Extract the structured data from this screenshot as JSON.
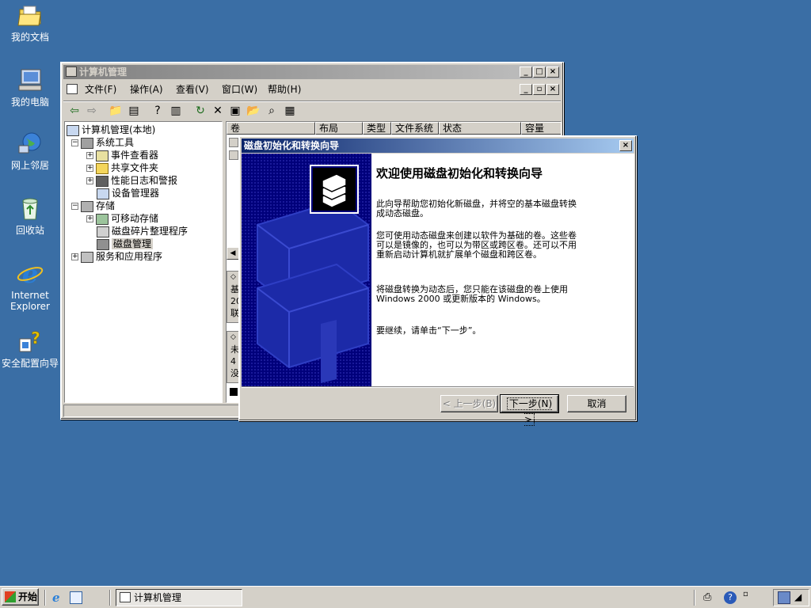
{
  "desktop": {
    "icons": [
      {
        "label": "我的文档",
        "icon": "my-documents-icon"
      },
      {
        "label": "我的电脑",
        "icon": "my-computer-icon"
      },
      {
        "label": "网上邻居",
        "icon": "network-icon"
      },
      {
        "label": "回收站",
        "icon": "recycle-bin-icon"
      },
      {
        "label_line1": "Internet",
        "label_line2": "Explorer",
        "icon": "ie-icon"
      },
      {
        "label": "安全配置向导",
        "icon": "security-wizard-icon"
      }
    ]
  },
  "main_window": {
    "title": "计算机管理",
    "menu": [
      "文件(F)",
      "操作(A)",
      "查看(V)",
      "窗口(W)",
      "帮助(H)"
    ],
    "tree": {
      "root": "计算机管理(本地)",
      "system_tools": "系统工具",
      "event_viewer": "事件查看器",
      "shared_folders": "共享文件夹",
      "perf_logs": "性能日志和警报",
      "device_manager": "设备管理器",
      "storage": "存储",
      "removable_storage": "可移动存储",
      "defrag": "磁盘碎片整理程序",
      "disk_mgmt": "磁盘管理",
      "services_apps": "服务和应用程序"
    },
    "columns": [
      "卷",
      "布局",
      "类型",
      "文件系统",
      "状态",
      "容量"
    ],
    "left_glimpse": [
      {
        "line1": "基",
        "line2": "20",
        "line3": "联"
      },
      {
        "line1": "未",
        "line2": "4",
        "line3": "没"
      }
    ]
  },
  "wizard": {
    "title": "磁盘初始化和转换向导",
    "heading": "欢迎使用磁盘初始化和转换向导",
    "para1_l1": "此向导帮助您初始化新磁盘，并将空的基本磁盘转换",
    "para1_l2": "成动态磁盘。",
    "para2_l1": "您可使用动态磁盘来创建以软件为基础的卷。这些卷",
    "para2_l2": "可以是镜像的，也可以为带区或跨区卷。还可以不用",
    "para2_l3": "重新启动计算机就扩展单个磁盘和跨区卷。",
    "para3_l1": "将磁盘转换为动态后，您只能在该磁盘的卷上使用",
    "para3_l2": "Windows 2000 或更新版本的 Windows。",
    "para4": "要继续，请单击“下一步”。",
    "back_label": "< 上一步(B)",
    "next_label": "下一步(N) >",
    "cancel_label": "取消"
  },
  "taskbar": {
    "start_label": "开始",
    "task_label": "计算机管理"
  },
  "colors": {
    "desktop": "#3a6ea5",
    "title_active": "#0a246a",
    "wizard_panel": "#00007b",
    "chrome": "#d4d0c8"
  }
}
